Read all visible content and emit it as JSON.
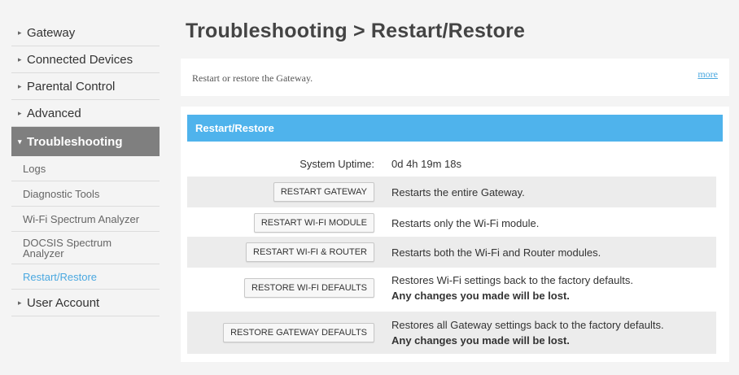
{
  "sidebar": {
    "items": [
      {
        "label": "Gateway"
      },
      {
        "label": "Connected Devices"
      },
      {
        "label": "Parental Control"
      },
      {
        "label": "Advanced"
      },
      {
        "label": "Troubleshooting"
      }
    ],
    "subitems": [
      {
        "label": "Logs"
      },
      {
        "label": "Diagnostic Tools"
      },
      {
        "label": "Wi-Fi Spectrum Analyzer"
      },
      {
        "label": "DOCSIS Spectrum Analyzer"
      },
      {
        "label": "Restart/Restore"
      }
    ],
    "user_account": "User Account",
    "active_color": "#7f7f7f",
    "current_sub_color": "#4aa8e0"
  },
  "page": {
    "title": "Troubleshooting > Restart/Restore",
    "intro": "Restart or restore the Gateway.",
    "more": "more"
  },
  "panel": {
    "header": "Restart/Restore",
    "header_color": "#4fb3ec",
    "uptime_label": "System Uptime:",
    "uptime_value": "0d 4h 19m 18s",
    "rows": [
      {
        "button": "RESTART GATEWAY",
        "desc": "Restarts the entire Gateway."
      },
      {
        "button": "RESTART WI-FI MODULE",
        "desc": "Restarts only the Wi-Fi module."
      },
      {
        "button": "RESTART WI-FI & ROUTER",
        "desc": "Restarts both the Wi-Fi and Router modules."
      },
      {
        "button": "RESTORE WI-FI DEFAULTS",
        "desc": "Restores Wi-Fi settings back to the factory defaults.",
        "warning": "Any changes you made will be lost."
      },
      {
        "button": "RESTORE GATEWAY DEFAULTS",
        "desc": "Restores all Gateway settings back to the factory defaults.",
        "warning": "Any changes you made will be lost."
      }
    ]
  }
}
